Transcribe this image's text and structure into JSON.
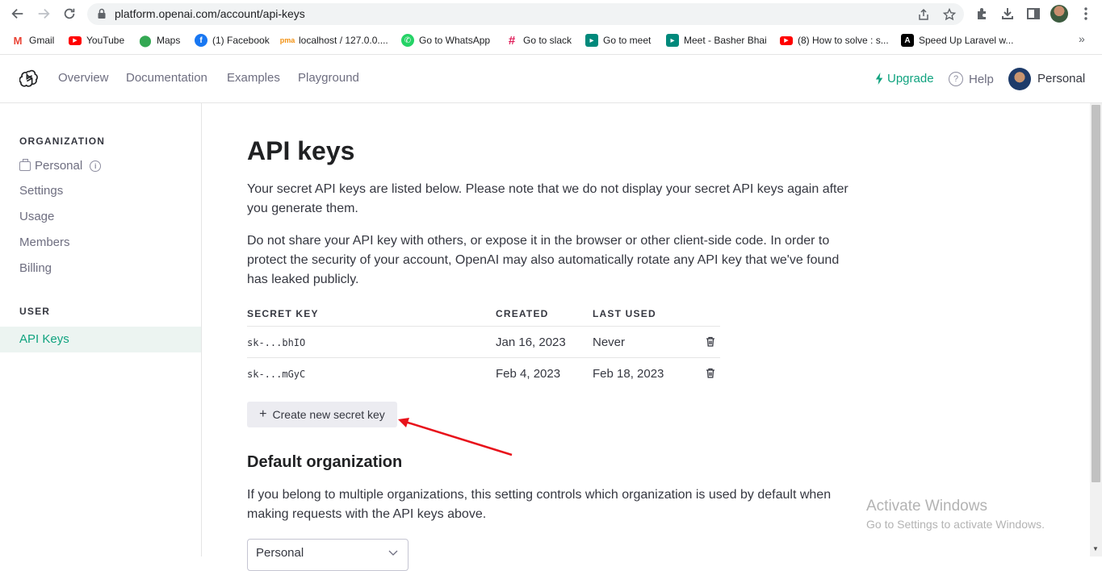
{
  "browser": {
    "url": "platform.openai.com/account/api-keys",
    "bookmarks": [
      {
        "label": "Gmail",
        "icon": "gmail-icon",
        "color": "#ea4335"
      },
      {
        "label": "YouTube",
        "icon": "youtube-icon",
        "color": "#ff0000"
      },
      {
        "label": "Maps",
        "icon": "maps-icon",
        "color": "#34a853"
      },
      {
        "label": "(1) Facebook",
        "icon": "facebook-icon",
        "color": "#1877f2"
      },
      {
        "label": "localhost / 127.0.0....",
        "icon": "phpmyadmin-icon",
        "color": "#f29111"
      },
      {
        "label": "Go to WhatsApp",
        "icon": "whatsapp-icon",
        "color": "#25d366"
      },
      {
        "label": "Go to slack",
        "icon": "slack-icon",
        "color": "#e01e5a"
      },
      {
        "label": "Go to meet",
        "icon": "meet-icon",
        "color": "#00897b"
      },
      {
        "label": "Meet - Basher Bhai",
        "icon": "meet-icon",
        "color": "#00897b"
      },
      {
        "label": "(8) How to solve : s...",
        "icon": "youtube-icon",
        "color": "#ff0000"
      },
      {
        "label": "Speed Up Laravel w...",
        "icon": "laravel-icon",
        "color": "#000000"
      }
    ],
    "more": "»"
  },
  "header": {
    "nav": [
      "Overview",
      "Documentation",
      "Examples",
      "Playground"
    ],
    "upgrade": "Upgrade",
    "help": "Help",
    "user": "Personal"
  },
  "sidebar": {
    "org_heading": "ORGANIZATION",
    "org_name": "Personal",
    "org_items": [
      "Settings",
      "Usage",
      "Members",
      "Billing"
    ],
    "user_heading": "USER",
    "active_item": "API Keys"
  },
  "main": {
    "title": "API keys",
    "para1": "Your secret API keys are listed below. Please note that we do not display your secret API keys again after you generate them.",
    "para2": "Do not share your API key with others, or expose it in the browser or other client-side code. In order to protect the security of your account, OpenAI may also automatically rotate any API key that we've found has leaked publicly.",
    "table": {
      "headers": [
        "SECRET KEY",
        "CREATED",
        "LAST USED"
      ],
      "rows": [
        {
          "key": "sk-...bhIO",
          "created": "Jan 16, 2023",
          "last_used": "Never"
        },
        {
          "key": "sk-...mGyC",
          "created": "Feb 4, 2023",
          "last_used": "Feb 18, 2023"
        }
      ]
    },
    "create_button": "Create new secret key",
    "default_org_title": "Default organization",
    "default_org_text": "If you belong to multiple organizations, this setting controls which organization is used by default when making requests with the API keys above.",
    "default_org_value": "Personal"
  },
  "watermark": {
    "title": "Activate Windows",
    "subtitle": "Go to Settings to activate Windows."
  },
  "colors": {
    "accent": "#10a37f",
    "annotation_arrow": "#e8121b"
  }
}
